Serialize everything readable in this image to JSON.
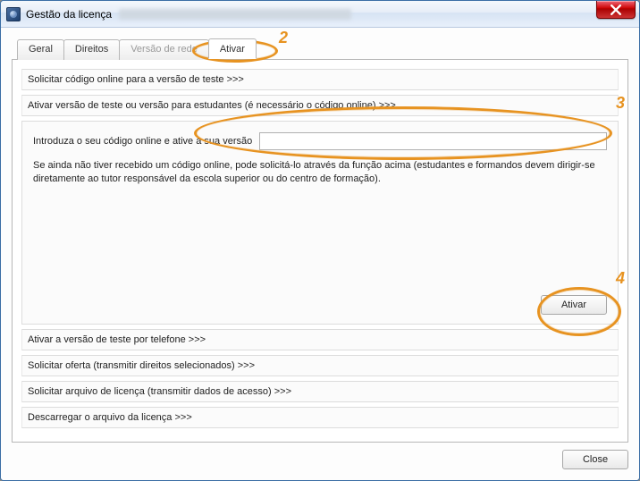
{
  "window": {
    "title": "Gestão da licença"
  },
  "tabs": {
    "geral": "Geral",
    "direitos": "Direitos",
    "versao_rede": "Versão de rede",
    "ativar": "Ativar"
  },
  "links": {
    "solicitar_codigo": "Solicitar código online para a versão de teste >>>",
    "ativar_versao_teste": "Ativar versão de teste ou versão para estudantes (é necessário o código online) >>>",
    "ativar_telefone": "Ativar a versão de teste por telefone >>>",
    "solicitar_oferta": "Solicitar oferta (transmitir direitos selecionados) >>>",
    "solicitar_arquivo": "Solicitar arquivo de licença (transmitir dados de acesso) >>>",
    "descarregar_arquivo": "Descarregar o arquivo da licença >>>"
  },
  "activation": {
    "field_label": "Introduza o seu código online e ative a sua versão",
    "code_value": "",
    "hint": "Se ainda não tiver recebido um código online, pode solicitá-lo através da função acima (estudantes e formandos devem dirigir-se diretamente ao tutor responsável da escola superior ou do centro de formação).",
    "button": "Ativar"
  },
  "buttons": {
    "close": "Close"
  },
  "annotations": {
    "n2": "2",
    "n3": "3",
    "n4": "4"
  }
}
